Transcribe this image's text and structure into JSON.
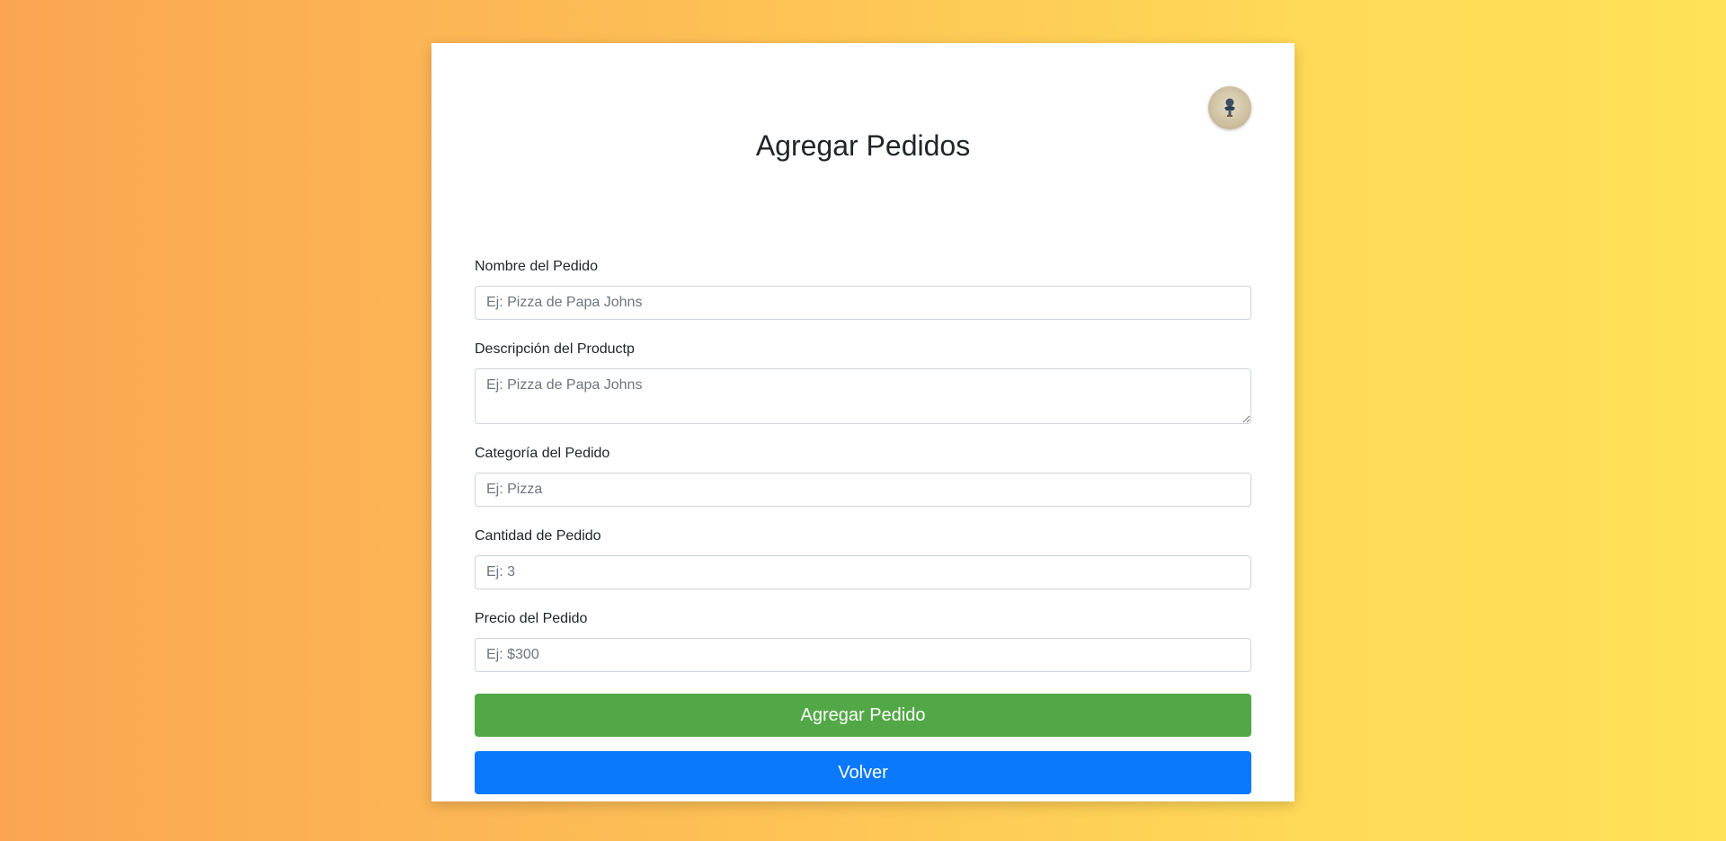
{
  "page": {
    "title": "Agregar Pedidos"
  },
  "avatar": {
    "icon": "avatar-figure-icon"
  },
  "form": {
    "fields": [
      {
        "label": "Nombre del Pedido",
        "placeholder": "Ej: Pizza de Papa Johns",
        "value": ""
      },
      {
        "label": "Descripción del Productp",
        "placeholder": "Ej: Pizza de Papa Johns",
        "value": ""
      },
      {
        "label": "Categoría del Pedido",
        "placeholder": "Ej: Pizza",
        "value": ""
      },
      {
        "label": "Cantidad de Pedido",
        "placeholder": "Ej: 3",
        "value": ""
      },
      {
        "label": "Precio del Pedido",
        "placeholder": "Ej: $300",
        "value": ""
      }
    ],
    "submit_label": "Agregar Pedido",
    "back_label": "Volver"
  },
  "colors": {
    "submit": "#52a846",
    "back": "#0b79fb",
    "gradient_start": "#fba552",
    "gradient_end": "#ffe257"
  }
}
